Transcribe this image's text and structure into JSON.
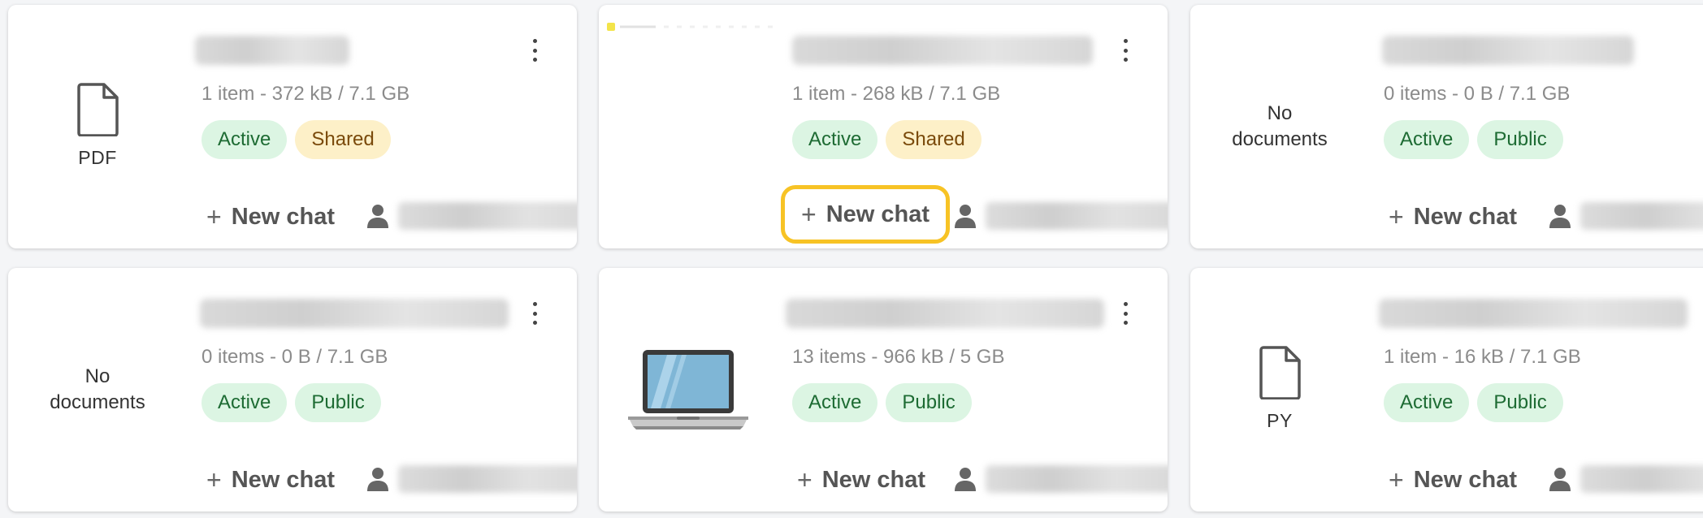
{
  "cards": [
    {
      "thumb": {
        "type": "file",
        "label": "PDF"
      },
      "meta": "1 item - 372 kB / 7.1 GB",
      "badges": [
        {
          "label": "Active",
          "kind": "active"
        },
        {
          "label": "Shared",
          "kind": "shared"
        }
      ],
      "new_chat": "New chat"
    },
    {
      "thumb": {
        "type": "blank"
      },
      "meta": "1 item - 268 kB / 7.1 GB",
      "badges": [
        {
          "label": "Active",
          "kind": "active"
        },
        {
          "label": "Shared",
          "kind": "shared"
        }
      ],
      "new_chat": "New chat",
      "highlighted": true
    },
    {
      "thumb": {
        "type": "nodocs",
        "label_line1": "No",
        "label_line2": "documents"
      },
      "meta": "0 items - 0 B / 7.1 GB",
      "badges": [
        {
          "label": "Active",
          "kind": "active"
        },
        {
          "label": "Public",
          "kind": "public"
        }
      ],
      "new_chat": "New chat"
    },
    {
      "thumb": {
        "type": "nodocs",
        "label_line1": "No",
        "label_line2": "documents"
      },
      "meta": "0 items - 0 B / 7.1 GB",
      "badges": [
        {
          "label": "Active",
          "kind": "active"
        },
        {
          "label": "Public",
          "kind": "public"
        }
      ],
      "new_chat": "New chat"
    },
    {
      "thumb": {
        "type": "laptop"
      },
      "meta": "13 items - 966 kB / 5 GB",
      "badges": [
        {
          "label": "Active",
          "kind": "active"
        },
        {
          "label": "Public",
          "kind": "public"
        }
      ],
      "new_chat": "New chat"
    },
    {
      "thumb": {
        "type": "file",
        "label": "PY"
      },
      "meta": "1 item - 16 kB / 7.1 GB",
      "badges": [
        {
          "label": "Active",
          "kind": "active"
        },
        {
          "label": "Public",
          "kind": "public"
        }
      ],
      "new_chat": "New chat"
    }
  ],
  "icons": {
    "file": "file-icon",
    "kebab": "more-vertical-icon",
    "plus": "plus-icon",
    "person": "person-icon",
    "laptop": "laptop-icon"
  },
  "colors": {
    "highlight": "#f7c325",
    "active_bg": "#dcf5e3",
    "shared_bg": "#fdf0c8"
  }
}
